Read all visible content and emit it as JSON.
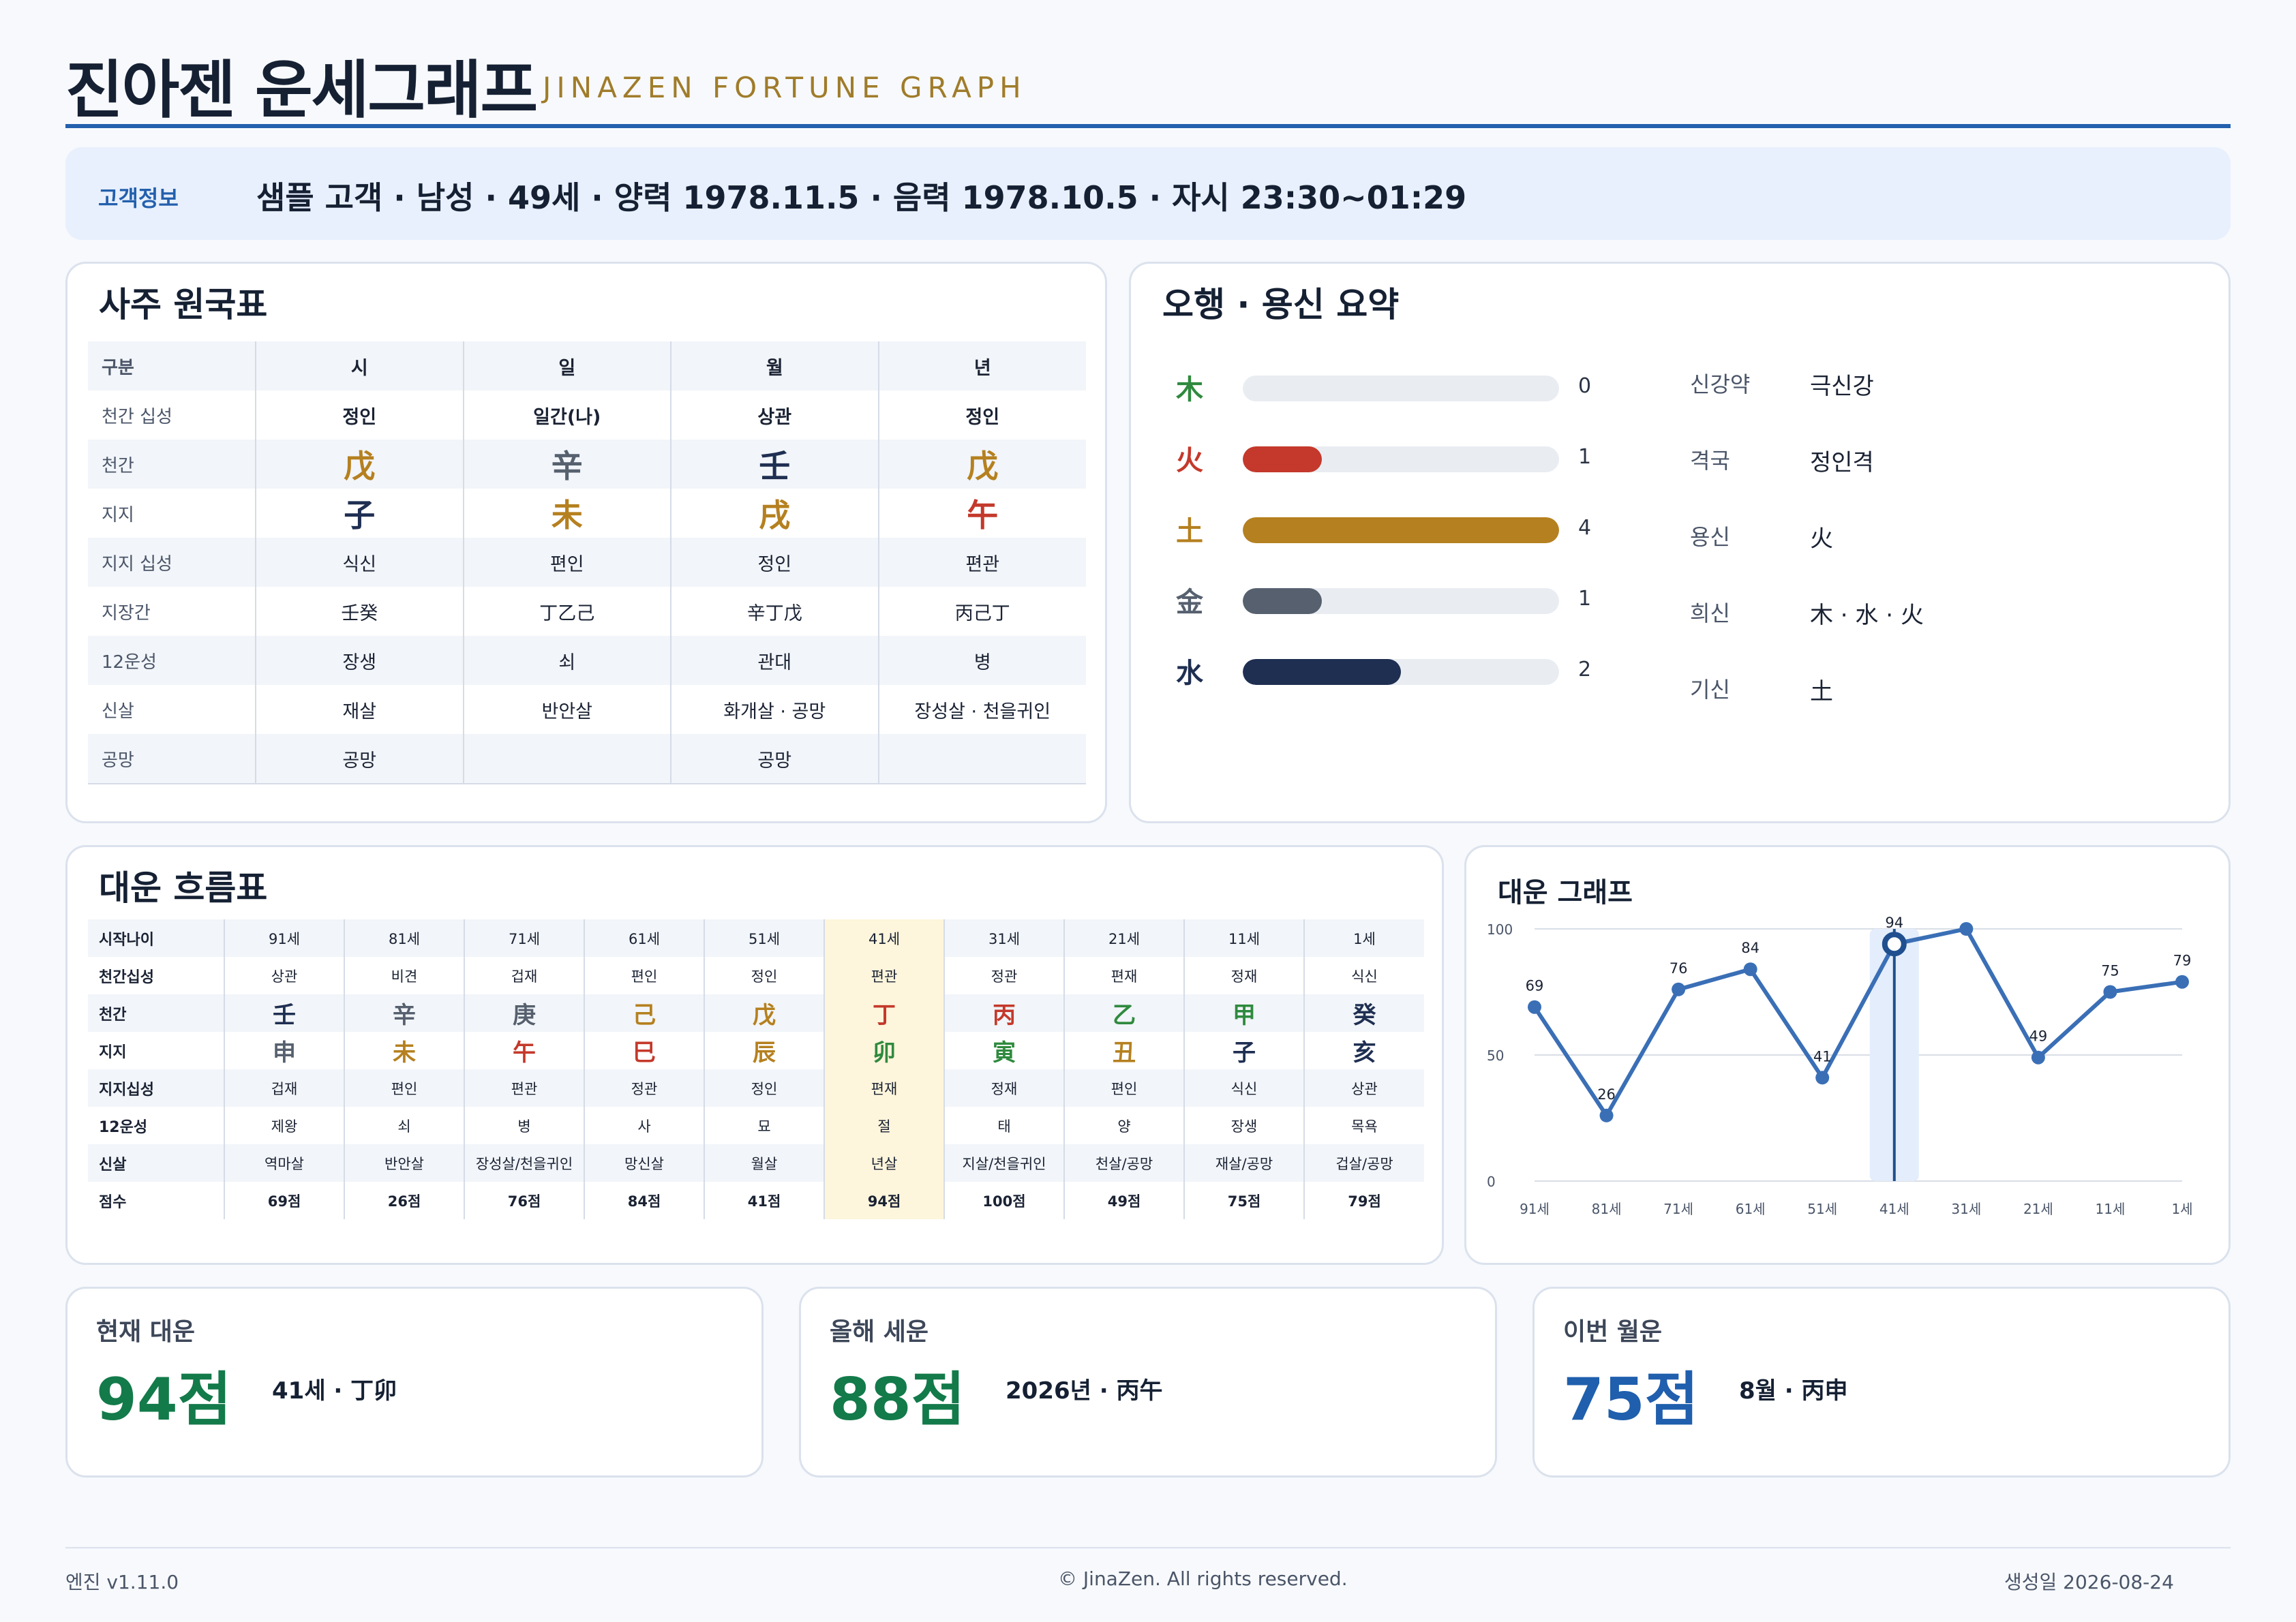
{
  "header": {
    "title": "진아젠 운세그래프",
    "subtitle": "JINAZEN FORTUNE GRAPH"
  },
  "customer": {
    "label": "고객정보",
    "text": "샘플 고객 · 남성 · 49세 · 양력 1978.11.5 · 음력 1978.10.5 · 자시 23:30~01:29"
  },
  "saju": {
    "title": "사주 원국표",
    "rows": [
      {
        "label": "구분",
        "cells": [
          {
            "t": "시"
          },
          {
            "t": "일"
          },
          {
            "t": "월"
          },
          {
            "t": "년"
          }
        ]
      },
      {
        "label": "천간 십성",
        "cells": [
          {
            "t": "정인"
          },
          {
            "t": "일간(나)"
          },
          {
            "t": "상관"
          },
          {
            "t": "정인"
          }
        ]
      },
      {
        "label": "천간",
        "cells": [
          {
            "t": "戊",
            "c": "#b5801f"
          },
          {
            "t": "辛",
            "c": "#56606e"
          },
          {
            "t": "壬",
            "c": "#1f2f52"
          },
          {
            "t": "戊",
            "c": "#b5801f"
          }
        ]
      },
      {
        "label": "지지",
        "cells": [
          {
            "t": "子",
            "c": "#1f2f52"
          },
          {
            "t": "未",
            "c": "#b5801f"
          },
          {
            "t": "戌",
            "c": "#b5801f"
          },
          {
            "t": "午",
            "c": "#c4392b"
          }
        ]
      },
      {
        "label": "지지 십성",
        "cells": [
          {
            "t": "식신"
          },
          {
            "t": "편인"
          },
          {
            "t": "정인"
          },
          {
            "t": "편관"
          }
        ]
      },
      {
        "label": "지장간",
        "cells": [
          {
            "t": "壬癸"
          },
          {
            "t": "丁乙己"
          },
          {
            "t": "辛丁戊"
          },
          {
            "t": "丙己丁"
          }
        ]
      },
      {
        "label": "12운성",
        "cells": [
          {
            "t": "장생"
          },
          {
            "t": "쇠"
          },
          {
            "t": "관대"
          },
          {
            "t": "병"
          }
        ]
      },
      {
        "label": "신살",
        "cells": [
          {
            "t": "재살"
          },
          {
            "t": "반안살"
          },
          {
            "t": "화개살 · 공망"
          },
          {
            "t": "장성살 · 천을귀인"
          }
        ]
      },
      {
        "label": "공망",
        "cells": [
          {
            "t": "공망"
          },
          {
            "t": ""
          },
          {
            "t": "공망"
          },
          {
            "t": ""
          }
        ]
      }
    ]
  },
  "ohaeng": {
    "title": "오행 · 용신 요약",
    "max": 4,
    "elements": [
      {
        "char": "木",
        "count": 0,
        "color": "#2f8a3e"
      },
      {
        "char": "火",
        "count": 1,
        "color": "#c4392b"
      },
      {
        "char": "土",
        "count": 4,
        "color": "#b5801f"
      },
      {
        "char": "金",
        "count": 1,
        "color": "#56606e"
      },
      {
        "char": "水",
        "count": 2,
        "color": "#1f2f52"
      }
    ],
    "yongsin": [
      {
        "key": "신강약",
        "value": "극신강"
      },
      {
        "key": "격국",
        "value": "정인격"
      },
      {
        "key": "용신",
        "value": "火"
      },
      {
        "key": "희신",
        "value": "木 · 水 · 火"
      },
      {
        "key": "기신",
        "value": "土"
      }
    ]
  },
  "daeun": {
    "title": "대운 흐름표",
    "highlight_index": 5,
    "row_labels": [
      "시작나이",
      "천간십성",
      "천간",
      "지지",
      "지지십성",
      "12운성",
      "신살",
      "점수"
    ],
    "columns": [
      {
        "age": "91세",
        "cs": "상관",
        "g": "壬",
        "gc": "#1f2f52",
        "j": "申",
        "jc": "#56606e",
        "js": "겁재",
        "u": "제왕",
        "sin": "역마살",
        "score": "69점"
      },
      {
        "age": "81세",
        "cs": "비견",
        "g": "辛",
        "gc": "#56606e",
        "j": "未",
        "jc": "#b5801f",
        "js": "편인",
        "u": "쇠",
        "sin": "반안살",
        "score": "26점"
      },
      {
        "age": "71세",
        "cs": "겁재",
        "g": "庚",
        "gc": "#56606e",
        "j": "午",
        "jc": "#c4392b",
        "js": "편관",
        "u": "병",
        "sin": "장성살/천을귀인",
        "score": "76점"
      },
      {
        "age": "61세",
        "cs": "편인",
        "g": "己",
        "gc": "#b5801f",
        "j": "巳",
        "jc": "#c4392b",
        "js": "정관",
        "u": "사",
        "sin": "망신살",
        "score": "84점"
      },
      {
        "age": "51세",
        "cs": "정인",
        "g": "戊",
        "gc": "#b5801f",
        "j": "辰",
        "jc": "#b5801f",
        "js": "정인",
        "u": "묘",
        "sin": "월살",
        "score": "41점"
      },
      {
        "age": "41세",
        "cs": "편관",
        "g": "丁",
        "gc": "#c4392b",
        "j": "卯",
        "jc": "#2f8a3e",
        "js": "편재",
        "u": "절",
        "sin": "년살",
        "score": "94점"
      },
      {
        "age": "31세",
        "cs": "정관",
        "g": "丙",
        "gc": "#c4392b",
        "j": "寅",
        "jc": "#2f8a3e",
        "js": "정재",
        "u": "태",
        "sin": "지살/천을귀인",
        "score": "100점"
      },
      {
        "age": "21세",
        "cs": "편재",
        "g": "乙",
        "gc": "#2f8a3e",
        "j": "丑",
        "jc": "#b5801f",
        "js": "편인",
        "u": "양",
        "sin": "천살/공망",
        "score": "49점"
      },
      {
        "age": "11세",
        "cs": "정재",
        "g": "甲",
        "gc": "#2f8a3e",
        "j": "子",
        "jc": "#1f2f52",
        "js": "식신",
        "u": "장생",
        "sin": "재살/공망",
        "score": "75점"
      },
      {
        "age": "1세",
        "cs": "식신",
        "g": "癸",
        "gc": "#1f2f52",
        "j": "亥",
        "jc": "#1f2f52",
        "js": "상관",
        "u": "목욕",
        "sin": "겁살/공망",
        "score": "79점"
      }
    ]
  },
  "chart_data": {
    "type": "line",
    "title": "대운 그래프",
    "categories": [
      "91세",
      "81세",
      "71세",
      "61세",
      "51세",
      "41세",
      "31세",
      "21세",
      "11세",
      "1세"
    ],
    "values": [
      69,
      26,
      76,
      84,
      41,
      94,
      100,
      49,
      75,
      79
    ],
    "ylim": [
      0,
      100
    ],
    "yticks": [
      0,
      50,
      100
    ],
    "highlight_index": 5,
    "line_color": "#3a6fb6",
    "grid": true
  },
  "summary": [
    {
      "label": "현재 대운",
      "score": "94점",
      "detail": "41세 · 丁卯",
      "color": "#137a4a"
    },
    {
      "label": "올해 세운",
      "score": "88점",
      "detail": "2026년 · 丙午",
      "color": "#137a4a"
    },
    {
      "label": "이번 월운",
      "score": "75점",
      "detail": "8월 · 丙申",
      "color": "#1f5fad"
    }
  ],
  "footer": {
    "engine": "엔진 v1.11.0",
    "copyright": "© JinaZen. All rights reserved.",
    "date": "생성일 2026-08-24"
  }
}
